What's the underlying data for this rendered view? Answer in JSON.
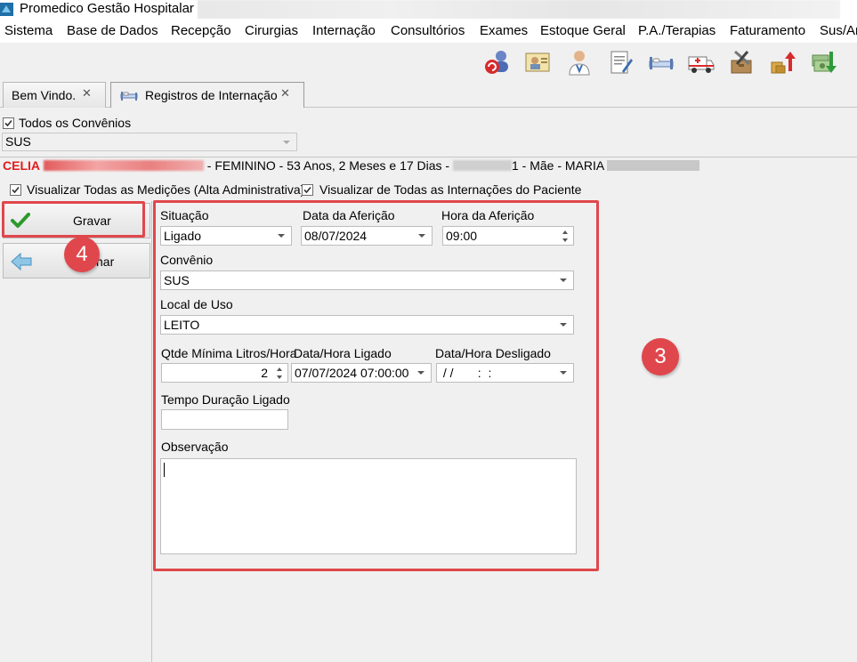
{
  "window": {
    "title": "Promedico Gestão Hospitalar"
  },
  "menu": [
    "Sistema",
    "Base de Dados",
    "Recepção",
    "Cirurgias",
    "Internação",
    "Consultórios",
    "Exames",
    "Estoque Geral",
    "P.A./Terapias",
    "Faturamento",
    "Sus/Ar"
  ],
  "toolbar": {
    "icons": [
      "users-refresh-icon",
      "patient-card-icon",
      "doctor-icon",
      "document-pen-icon",
      "hospital-bed-icon",
      "ambulance-icon",
      "tools-box-icon",
      "stock-up-icon",
      "cash-down-icon"
    ]
  },
  "tabs": [
    {
      "label": "Bem Vindo.",
      "close": "✕"
    },
    {
      "label": "Registros de Internação",
      "close": "✕"
    }
  ],
  "filters": {
    "todos_convenios_label": "Todos os Convênios",
    "convenio_value": "SUS"
  },
  "patient": {
    "name_start": "CELIA",
    "info": "- FEMININO - 53 Anos, 2 Meses e 17 Dias -",
    "date_fragment": "1 - Mãe - MARIA"
  },
  "options": {
    "medicoes_label": "Visualizar Todas as Medições (Alta Administrativa)",
    "internacoes_label": "Visualizar de Todas as Internações do Paciente"
  },
  "actions": {
    "save_label": "Gravar",
    "back_label_fragment": "nar"
  },
  "form": {
    "situacao_label": "Situação",
    "situacao_value": "Ligado",
    "data_afericao_label": "Data da Aferição",
    "data_afericao_value": "08/07/2024",
    "hora_afericao_label": "Hora da Aferição",
    "hora_afericao_value": "09:00",
    "convenio_label": "Convênio",
    "convenio_value": "SUS",
    "local_uso_label": "Local de Uso",
    "local_uso_value": "LEITO",
    "qtde_label": "Qtde Mínima Litros/Hora",
    "qtde_value": "2",
    "data_ligado_label": "Data/Hora Ligado",
    "data_ligado_value": "07/07/2024 07:00:00",
    "data_desligado_label": "Data/Hora Desligado",
    "data_desligado_value": " / /       :  :",
    "tempo_label": "Tempo Duração Ligado",
    "tempo_value": "",
    "observacao_label": "Observação",
    "observacao_value": ""
  },
  "callouts": {
    "form_badge": "3",
    "save_badge": "4"
  },
  "colors": {
    "accent_red": "#e0474c",
    "patient_red": "#e41b1b"
  }
}
